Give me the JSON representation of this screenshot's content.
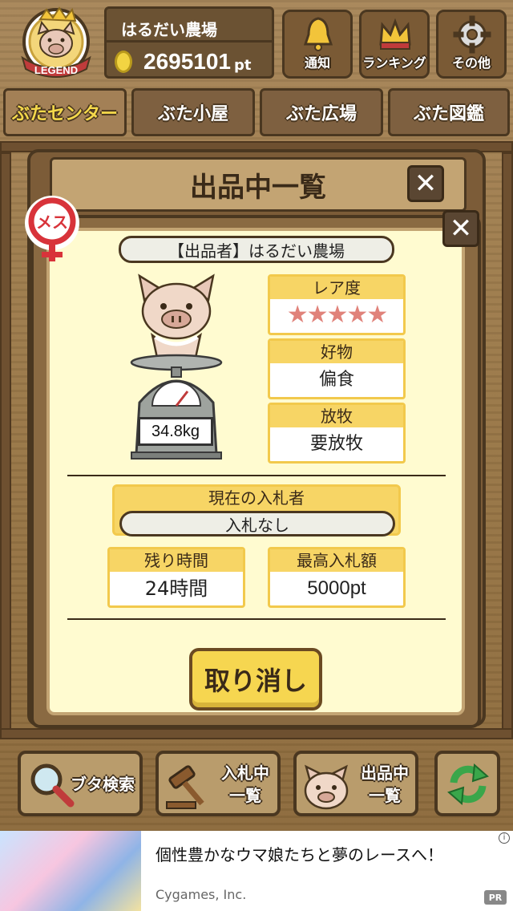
{
  "header": {
    "badge_text": "LEGEND",
    "farm_name": "はるだい農場",
    "points": "2695101",
    "points_unit": "pt",
    "buttons": {
      "notify": "通知",
      "ranking": "ランキング",
      "other": "その他"
    }
  },
  "tabs": [
    "ぶたセンター",
    "ぶた小屋",
    "ぶた広場",
    "ぶた図鑑"
  ],
  "list_window": {
    "title": "出品中一覧",
    "close": "✕"
  },
  "detail": {
    "gender": "メス",
    "close": "✕",
    "seller": "【出品者】はるだい農場",
    "weight": "34.8kg",
    "rarity_label": "レア度",
    "rarity_stars": "★★★★★",
    "favorite_label": "好物",
    "favorite_value": "偏食",
    "grazing_label": "放牧",
    "grazing_value": "要放牧",
    "bidder_label": "現在の入札者",
    "bidder_value": "入札なし",
    "time_label": "残り時間",
    "time_value": "24時間",
    "max_bid_label": "最高入札額",
    "max_bid_value": "5000pt",
    "cancel_button": "取り消し"
  },
  "toolbar": {
    "search": "ブタ検索",
    "bidding_line1": "入札中",
    "bidding_line2": "一覧",
    "listing_line1": "出品中",
    "listing_line2": "一覧"
  },
  "ad": {
    "headline": "個性豊かなウマ娘たちと夢のレースへ！",
    "advertiser": "Cygames, Inc.",
    "pr": "PR",
    "info": "i"
  }
}
